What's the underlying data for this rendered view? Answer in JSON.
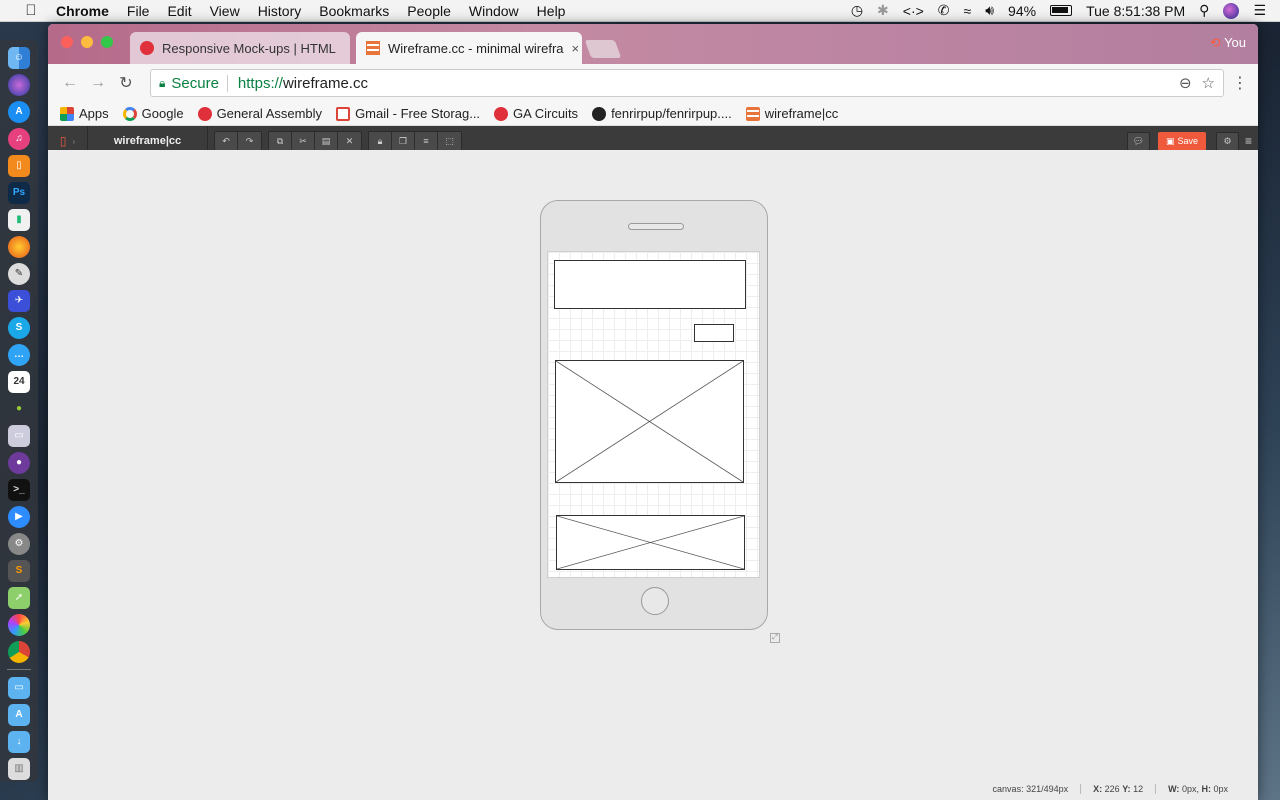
{
  "menubar": {
    "app_name": "Chrome",
    "items": [
      "File",
      "Edit",
      "View",
      "History",
      "Bookmarks",
      "People",
      "Window",
      "Help"
    ],
    "battery": "94%",
    "clock": "Tue 8:51:38 PM"
  },
  "browser": {
    "tabs": [
      {
        "title": "Responsive Mock-ups | HTML",
        "active": false
      },
      {
        "title": "Wireframe.cc - minimal wirefra",
        "active": true
      }
    ],
    "tab_close": "×",
    "user_label": "You",
    "address": {
      "secure_label": "Secure",
      "scheme": "https://",
      "host": "wireframe.cc"
    },
    "bookmarks": [
      {
        "label": "Apps"
      },
      {
        "label": "Google"
      },
      {
        "label": "General Assembly"
      },
      {
        "label": "Gmail - Free Storag..."
      },
      {
        "label": "GA Circuits"
      },
      {
        "label": "fenrirpup/fenrirpup...."
      },
      {
        "label": "wireframe|cc"
      }
    ]
  },
  "app": {
    "logo": "wireframe|cc",
    "save_label": "Save"
  },
  "statusbar": {
    "canvas_label": "canvas:",
    "canvas_value": "321/494px",
    "x_label": "X:",
    "x_value": "226",
    "y_label": "Y:",
    "y_value": "12",
    "w_label": "W:",
    "w_value": "0px,",
    "h_label": "H:",
    "h_value": "0px"
  },
  "colors": {
    "accent": "#f05a3c",
    "secure_green": "#0b8043",
    "app_toolbar": "#3b3b3b"
  }
}
